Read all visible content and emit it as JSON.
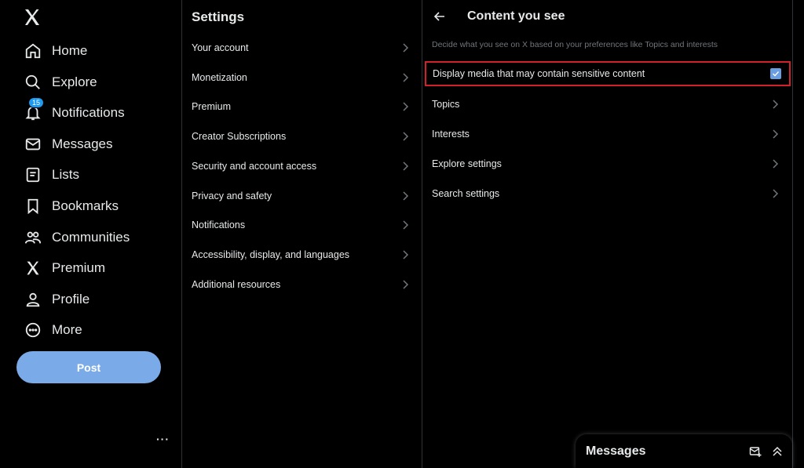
{
  "nav": {
    "items": [
      {
        "label": "Home",
        "icon": "home-icon"
      },
      {
        "label": "Explore",
        "icon": "search-icon"
      },
      {
        "label": "Notifications",
        "icon": "bell-icon",
        "badge": "15"
      },
      {
        "label": "Messages",
        "icon": "envelope-icon"
      },
      {
        "label": "Lists",
        "icon": "list-icon"
      },
      {
        "label": "Bookmarks",
        "icon": "bookmark-icon"
      },
      {
        "label": "Communities",
        "icon": "people-icon"
      },
      {
        "label": "Premium",
        "icon": "x-logo-icon"
      },
      {
        "label": "Profile",
        "icon": "person-icon"
      },
      {
        "label": "More",
        "icon": "more-circle-icon"
      }
    ],
    "post_label": "Post",
    "more_dots": "···"
  },
  "settings": {
    "title": "Settings",
    "items": [
      "Your account",
      "Monetization",
      "Premium",
      "Creator Subscriptions",
      "Security and account access",
      "Privacy and safety",
      "Notifications",
      "Accessibility, display, and languages",
      "Additional resources"
    ]
  },
  "content": {
    "title": "Content you see",
    "description": "Decide what you see on X based on your preferences like Topics and interests",
    "sensitive_label": "Display media that may contain sensitive content",
    "sensitive_checked": true,
    "items": [
      "Topics",
      "Interests",
      "Explore settings",
      "Search settings"
    ]
  },
  "messages_drawer": {
    "title": "Messages"
  },
  "colors": {
    "accent": "#1d9bf0",
    "post_button": "#7aabe8",
    "highlight_border": "#d3212b",
    "checkbox": "#6b9ee0"
  }
}
